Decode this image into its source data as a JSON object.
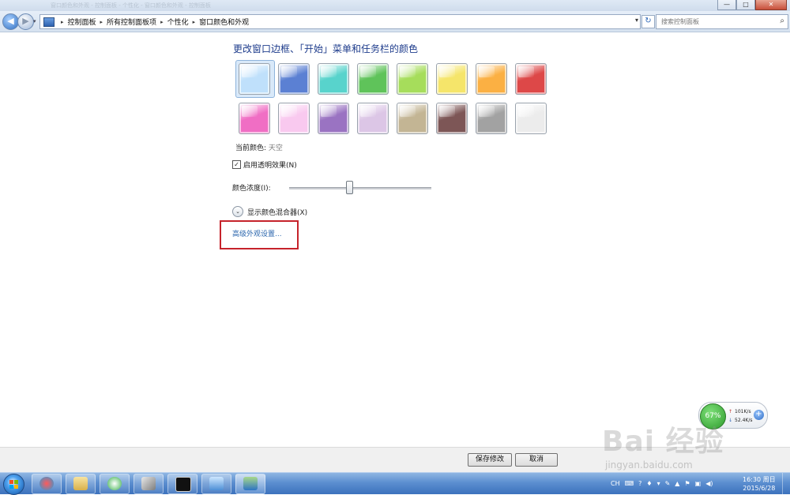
{
  "window": {
    "faint_title": "窗口颜色和外观 - 控制面板 - 个性化 - 窗口颜色和外观 - 控制面板",
    "min_label": "—",
    "max_label": "□",
    "close_label": "✕"
  },
  "nav": {
    "back_label": "◀",
    "forward_label": "▶",
    "recent_label": "▾",
    "breadcrumbs": [
      "控制面板",
      "所有控制面板项",
      "个性化",
      "窗口颜色和外观"
    ],
    "separator": "▸",
    "dropdown_label": "▾",
    "refresh_label": "↻",
    "search_placeholder": "搜索控制面板",
    "search_icon": "⌕"
  },
  "content": {
    "heading": "更改窗口边框、「开始」菜单和任务栏的颜色",
    "swatches": [
      {
        "name": "sky",
        "color": "#bfe0fb",
        "selected": true
      },
      {
        "name": "twilight",
        "color": "#5b80d3"
      },
      {
        "name": "sea",
        "color": "#58d3cc"
      },
      {
        "name": "leaf",
        "color": "#5fc35a"
      },
      {
        "name": "lime",
        "color": "#a6dd5b"
      },
      {
        "name": "banana",
        "color": "#f5e56a"
      },
      {
        "name": "pumpkin",
        "color": "#fbb043"
      },
      {
        "name": "ruby",
        "color": "#dd4848"
      },
      {
        "name": "fuchsia",
        "color": "#f06ec4"
      },
      {
        "name": "blush",
        "color": "#f9c9ef"
      },
      {
        "name": "violet",
        "color": "#9a73c2"
      },
      {
        "name": "lavender",
        "color": "#dcc6e6"
      },
      {
        "name": "taupe",
        "color": "#c3b594"
      },
      {
        "name": "chocolate",
        "color": "#7d5656"
      },
      {
        "name": "slate",
        "color": "#a2a2a2"
      },
      {
        "name": "frost",
        "color": "#ececec"
      }
    ],
    "current_color_label": "当前颜色:",
    "current_color_value": "天空",
    "transparency_label": "启用透明效果(N)",
    "transparency_checked": "✓",
    "intensity_label": "颜色浓度(I):",
    "intensity_level": 0.42,
    "mixer_label": "显示颜色混合器(X)",
    "mixer_icon": "⌄",
    "advanced_link": "高级外观设置..."
  },
  "buttons": {
    "save": "保存修改",
    "cancel": "取消"
  },
  "network_widget": {
    "percent": "67%",
    "up_arrow": "↑",
    "down_arrow": "↓",
    "up": "101K/s",
    "down": "52.4K/s",
    "plus": "+"
  },
  "watermark": {
    "logo": "Bai 经验",
    "url": "jingyan.baidu.com"
  },
  "taskbar": {
    "apps": [
      "start-orb",
      "360",
      "explorer",
      "browser",
      "tool",
      "cmd",
      "remote",
      "control-panel"
    ],
    "tray_items": [
      "CH",
      "⌨",
      "?",
      "♦",
      "▾",
      "✎",
      "▲",
      "⚑",
      "▣",
      "◀)"
    ],
    "time": "16:30 周日",
    "date": "2015/6/28"
  },
  "colors": {
    "heading": "#1e3c8c",
    "link": "#2b66ad",
    "highlight_box": "#c6232b",
    "taskbar": "#3c72bd"
  }
}
